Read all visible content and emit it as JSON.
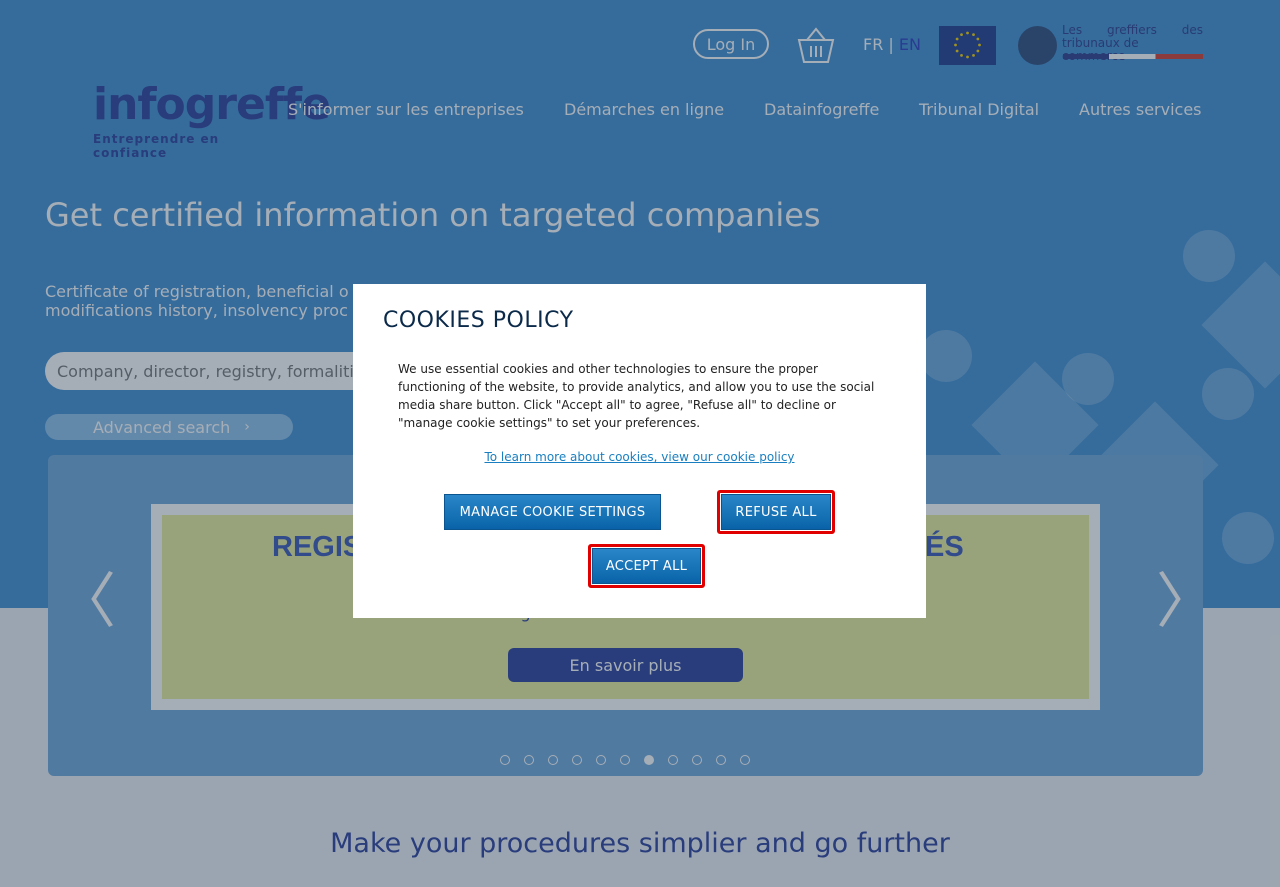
{
  "header": {
    "login_label": "Log In",
    "lang_fr": "FR",
    "lang_sep": "|",
    "lang_en": "EN",
    "greffiers_line1_a": "Les",
    "greffiers_line1_b": "greffiers",
    "greffiers_line1_c": "des",
    "greffiers_line2": "tribunaux de commerce"
  },
  "logo": {
    "word": "infogreffe",
    "tagline": "Entreprendre en confiance"
  },
  "nav": {
    "items": [
      {
        "label": "S'informer sur les entreprises"
      },
      {
        "label": "Démarches en ligne"
      },
      {
        "label": "Datainfogreffe"
      },
      {
        "label": "Tribunal Digital"
      },
      {
        "label": "Autres services"
      }
    ]
  },
  "hero": {
    "title": "Get certified information on targeted companies",
    "subtitle_line1": "Certificate of registration, beneficial o",
    "subtitle_line2": "modifications history, insolvency proc",
    "search_placeholder": "Company, director, registry, formaliti",
    "advanced_search": "Advanced search",
    "advanced_chevron": "›"
  },
  "carousel": {
    "slide_title_left": "REGIS",
    "slide_title_right": "ÉS",
    "slide_text": "stockage dans un centre fort souverain",
    "slide_button": "En savoir plus",
    "prev": "〈",
    "next": "〉",
    "dot_count": 11,
    "active_dot": 7
  },
  "bottom": {
    "title": "Make your procedures simplier and go further"
  },
  "cookies": {
    "title": "COOKIES POLICY",
    "body": "We use essential cookies and other technologies to ensure the proper functioning of the website, to provide analytics, and allow you to use the social media share button. Click \"Accept all\" to agree, \"Refuse all\" to decline or \"manage cookie settings\" to set your preferences.",
    "link": "To learn more about cookies, view our cookie policy",
    "manage_label": "MANAGE COOKIE SETTINGS",
    "refuse_label": "REFUSE ALL",
    "accept_label": "ACCEPT ALL"
  },
  "colors": {
    "hero_blue": "#3f8fd3",
    "brand_navy": "#2a3d9a",
    "button_blue": "#1a78c0",
    "highlight_red": "#e00000"
  },
  "icons": [
    "basket-icon",
    "eu-flag-icon",
    "greffiers-logo",
    "chevron-right-icon",
    "chevron-left-icon"
  ]
}
